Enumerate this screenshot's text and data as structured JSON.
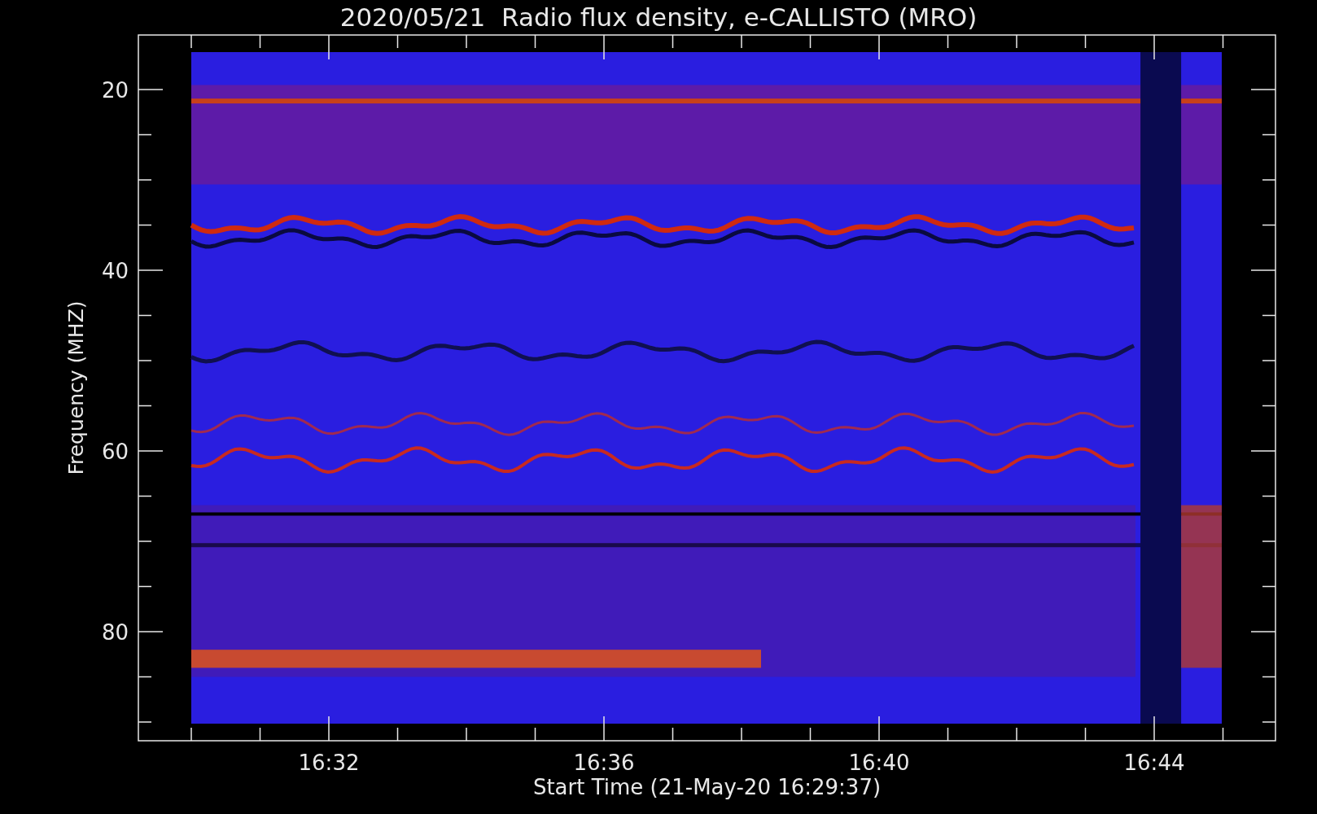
{
  "title": "2020/05/21  Radio flux density, e-CALLISTO (MRO)",
  "y_axis": {
    "label": "Frequency (MHZ)",
    "ticks": [
      "20",
      "40",
      "60",
      "80"
    ]
  },
  "x_axis": {
    "label": "Start Time (21-May-20 16:29:37)",
    "ticks": [
      "16:32",
      "16:36",
      "16:40",
      "16:44"
    ]
  }
}
